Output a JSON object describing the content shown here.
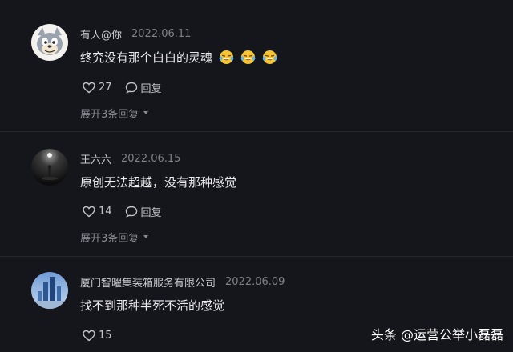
{
  "comments": [
    {
      "username": "有人@你",
      "date": "2022.06.11",
      "text": "终究没有那个白白的灵魂",
      "emojis": [
        "laughing-crying-emoji",
        "laughing-crying-emoji",
        "laughing-crying-emoji"
      ],
      "likes": "27",
      "reply_label": "回复",
      "expand_label": "展开3条回复"
    },
    {
      "username": "王六六",
      "date": "2022.06.15",
      "text": "原创无法超越，没有那种感觉",
      "likes": "14",
      "reply_label": "回复",
      "expand_label": "展开3条回复"
    },
    {
      "username": "厦门智曜集装箱服务有限公司",
      "date": "2022.06.09",
      "text": "找不到那种半死不活的感觉",
      "likes": "15"
    }
  ],
  "watermark": "头条 @运营公举小磊磊",
  "colors": {
    "background": "#15161b",
    "username": "#c9cad0",
    "date": "#7f8088",
    "text": "#ebebef"
  }
}
